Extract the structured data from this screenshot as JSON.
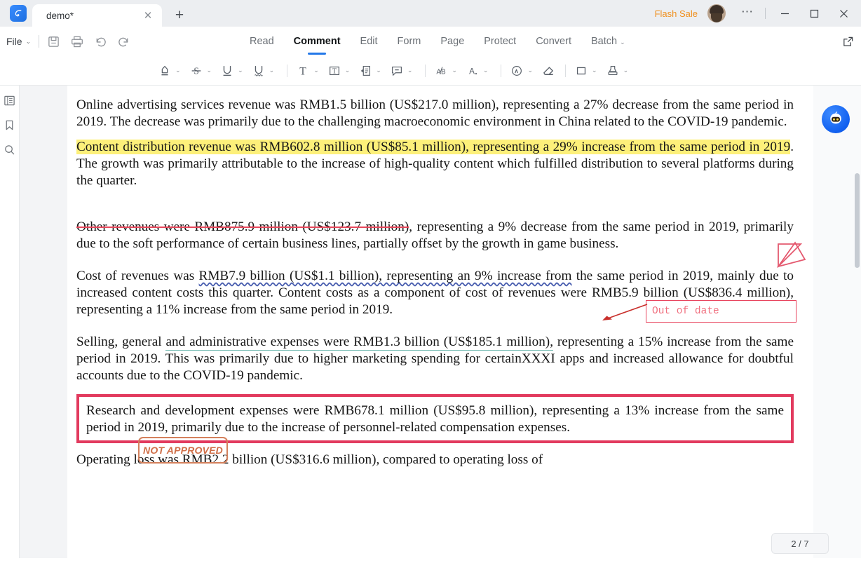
{
  "titlebar": {
    "logo_icon": "app-logo-icon",
    "tab_label": "demo*",
    "close_icon": "close-icon",
    "newtab_label": "+",
    "flash_sale": "Flash Sale",
    "more_label": "⋯",
    "minimize_label": "—",
    "maximize_label": "□",
    "close_label": "✕"
  },
  "menubar": {
    "file_label": "File",
    "chevron": "⌄",
    "quick_icons": [
      "save-icon",
      "print-icon",
      "undo-icon",
      "redo-icon"
    ],
    "tabs": [
      {
        "label": "Read",
        "active": false
      },
      {
        "label": "Comment",
        "active": true
      },
      {
        "label": "Edit",
        "active": false
      },
      {
        "label": "Form",
        "active": false
      },
      {
        "label": "Page",
        "active": false
      },
      {
        "label": "Protect",
        "active": false
      },
      {
        "label": "Convert",
        "active": false
      },
      {
        "label": "Batch",
        "active": false,
        "chevron": "⌄"
      }
    ],
    "expand_icon": "expand-external-icon"
  },
  "ribbon": {
    "tools": [
      {
        "name": "highlight-tool",
        "chevron": true
      },
      {
        "name": "strikethrough-tool",
        "chevron": true
      },
      {
        "name": "underline-tool",
        "chevron": true
      },
      {
        "name": "squiggly-underline-tool",
        "chevron": true
      },
      {
        "name": "text-tool",
        "chevron": true
      },
      {
        "name": "text-box-tool",
        "chevron": true
      },
      {
        "name": "note-anchor-tool",
        "chevron": true
      },
      {
        "name": "comment-tool",
        "chevron": true
      },
      {
        "name": "replace-text-tool",
        "chevron": true
      },
      {
        "name": "insert-text-tool",
        "chevron": true
      },
      {
        "name": "pencil-draw-tool",
        "chevron": true
      },
      {
        "name": "eraser-tool",
        "chevron": false
      },
      {
        "name": "shape-rectangle-tool",
        "chevron": true
      },
      {
        "name": "stamp-tool",
        "chevron": true
      }
    ]
  },
  "leftrail": {
    "items": [
      "thumbnails-icon",
      "bookmark-icon",
      "search-icon"
    ]
  },
  "rightrail": {
    "ai_bot_icon": "ai-assistant-icon"
  },
  "document": {
    "paragraphs": [
      {
        "id": "p-online-advertising",
        "runs": [
          {
            "text": "Online advertising services revenue was RMB1.5 billion (US$217.0 million), representing a 27% decrease from the same period in 2019. The decrease was primarily due to the challenging macroeconomic environment in China related to the COVID-19 pandemic.",
            "style": "plain"
          }
        ]
      },
      {
        "id": "p-content-distribution",
        "runs": [
          {
            "text": "Content distribution revenue was RMB602.8 million (US$85.1 million), representing a 29% increase from the same period in 2019",
            "style": "highlight"
          },
          {
            "text": ". The growth was primarily attributable to the increase of high-quality content which fulfilled distribution to several platforms during the quarter.",
            "style": "plain"
          }
        ]
      },
      {
        "id": "p-other-revenues",
        "runs": [
          {
            "text": "Other revenues were RMB875.9 million (US$123.7 million)",
            "style": "strikethrough"
          },
          {
            "text": ", representing a 9% decrease from the same period in 2019, primarily due to the soft performance of certain business lines, partially offset by the growth in game business.",
            "style": "plain"
          }
        ]
      },
      {
        "id": "p-cost-of-revenues",
        "runs": [
          {
            "text": "Cost of revenues was ",
            "style": "plain"
          },
          {
            "text": "RMB7.9 billion (US$1.1 billion), representing an 9% increase from",
            "style": "squiggly"
          },
          {
            "text": " the same period in 2019, mainly due to increased content costs this quarter. Content costs as a component of cost of revenues were RMB5.9 billion (US$836.4 million), representing a 11% increase from the same period in 2019.",
            "style": "plain"
          }
        ]
      },
      {
        "id": "p-selling-general",
        "runs": [
          {
            "text": "Selling, general ",
            "style": "plain"
          },
          {
            "text": "and administrative expenses were RMB1.3 billion (US$185.1 million),",
            "style": "underline-teal"
          },
          {
            "text": " representing a 15% increase from the same period in 2019. This was primarily due to higher marketing spending for certainXXXI apps and increased allowance for doubtful accounts due to the COVID-19 pandemic.",
            "style": "plain"
          }
        ]
      }
    ],
    "boxed_paragraph": {
      "id": "p-research-development",
      "text": "Research and development expenses were RMB678.1 million (US$95.8 million), representing a 13% increase from the same period in 2019, primarily due to the increase of personnel-related compensation expenses."
    },
    "tail_paragraph": {
      "id": "p-operating-loss",
      "text": "Operating loss was RMB2.2 billion (US$316.6 million), compared to operating loss of"
    }
  },
  "annotations": {
    "stamp_text": "NOT APPROVED",
    "callout_text": "Out of date",
    "arrow_icon": "annotation-arrow-icon",
    "caret_icon": "annotation-caret-mark-icon"
  },
  "status": {
    "page_indicator": "2 / 7"
  },
  "colors": {
    "accent_blue": "#2478e8",
    "flash_sale_orange": "#f0901e",
    "highlight_yellow": "#fdf07a",
    "strike_red": "#e8485c",
    "box_red": "#e23a5e",
    "stamp_orange": "#cf6d46",
    "squiggly_blue": "#4a5fb0",
    "underline_teal": "#6fb8b0"
  }
}
